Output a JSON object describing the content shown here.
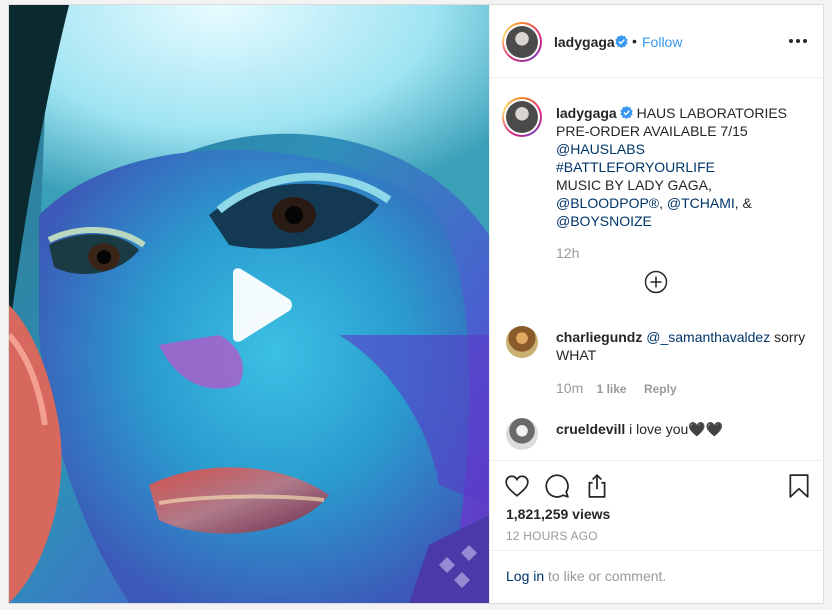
{
  "header": {
    "username": "ladygaga",
    "separator": "•",
    "follow_label": "Follow"
  },
  "caption": {
    "username": "ladygaga",
    "lines": [
      "HAUS LABORATORIES",
      "PRE-ORDER AVAILABLE 7/15",
      "@HAUSLABS",
      "#BATTLEFORYOURLIFE",
      "MUSIC BY LADY GAGA,",
      "@BLOODPOP®",
      "@TCHAMI",
      "@BOYSNOIZE"
    ],
    "sep_comma": ", ",
    "sep_amp": ", &",
    "time": "12h"
  },
  "comments": [
    {
      "username": "charliegundz",
      "mention": "@_samanthavaldez",
      "text": " sorry WHAT",
      "time": "10m",
      "likes": "1 like",
      "reply": "Reply"
    },
    {
      "username": "crueldevill",
      "text": "i love you🖤🖤"
    }
  ],
  "stats": {
    "views": "1,821,259 views",
    "ago": "12 HOURS AGO"
  },
  "login": {
    "link": "Log in",
    "rest": " to like or comment."
  },
  "icons": [
    "play-icon",
    "verified-badge-icon",
    "more-options-icon",
    "load-more-comments-icon",
    "heart-icon",
    "comment-icon",
    "share-icon",
    "bookmark-icon"
  ],
  "colors": {
    "link_blue": "#3897f0",
    "tag_blue": "#003569",
    "muted": "#999999"
  }
}
